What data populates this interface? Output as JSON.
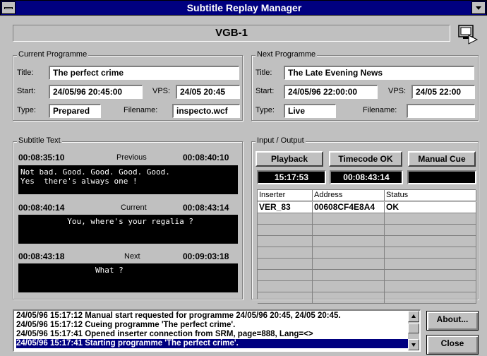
{
  "window": {
    "title": "Subtitle Replay Manager"
  },
  "channel": "VGB-1",
  "current": {
    "group_title": "Current Programme",
    "title_label": "Title:",
    "title": "The perfect crime",
    "start_label": "Start:",
    "start": "24/05/96 20:45:00",
    "vps_label": "VPS:",
    "vps": "24/05 20:45",
    "type_label": "Type:",
    "type": "Prepared",
    "filename_label": "Filename:",
    "filename": "inspecto.wcf"
  },
  "next": {
    "group_title": "Next Programme",
    "title_label": "Title:",
    "title": "The Late Evening News",
    "start_label": "Start:",
    "start": "24/05/96 22:00:00",
    "vps_label": "VPS:",
    "vps": "24/05 22:00",
    "type_label": "Type:",
    "type": "Live",
    "filename_label": "Filename:",
    "filename": ""
  },
  "subtitle": {
    "group_title": "Subtitle Text",
    "previous": {
      "start": "00:08:35:10",
      "label": "Previous",
      "end": "00:08:40:10",
      "text": "Not bad. Good. Good. Good. Good.\nYes  there's always one !"
    },
    "current": {
      "start": "00:08:40:14",
      "label": "Current",
      "end": "00:08:43:14",
      "text": "          You, where's your regalia ?"
    },
    "next": {
      "start": "00:08:43:18",
      "label": "Next",
      "end": "00:09:03:18",
      "text": "                What ?"
    }
  },
  "io": {
    "group_title": "Input / Output",
    "playback_label": "Playback",
    "timecode_label": "Timecode OK",
    "manual_cue_label": "Manual Cue",
    "clock": "15:17:53",
    "timecode": "00:08:43:14",
    "cue_display": "",
    "columns": [
      "Inserter",
      "Address",
      "Status"
    ],
    "rows": [
      [
        "VER_83",
        "00608CF4E8A4",
        "OK"
      ]
    ]
  },
  "log": [
    "24/05/96 15:17:12 Manual start requested for programme 24/05/96 20:45, 24/05 20:45.",
    "24/05/96 15:17:12 Cueing programme 'The perfect crime'.",
    "24/05/96 15:17:41 Opened inserter connection from SRM, page=888, Lang=<>",
    "24/05/96 15:17:41 Starting programme 'The perfect crime'."
  ],
  "buttons": {
    "about": "About...",
    "close": "Close"
  },
  "colors": {
    "titlebar": "#000080",
    "face": "#c0c0c0",
    "selection": "#000080"
  }
}
